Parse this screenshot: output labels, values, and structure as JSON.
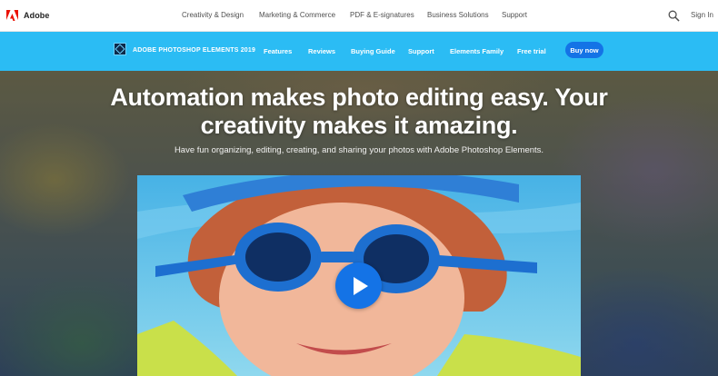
{
  "global_nav": {
    "brand": "Adobe",
    "links": [
      "Creativity & Design",
      "Marketing & Commerce",
      "PDF & E-signatures",
      "Business Solutions",
      "Support"
    ],
    "signin": "Sign In"
  },
  "product_nav": {
    "product_name": "ADOBE PHOTOSHOP ELEMENTS 2019",
    "items": [
      "Features",
      "Reviews",
      "Buying Guide",
      "Support",
      "Elements Family",
      "Free trial"
    ],
    "cta": "Buy now"
  },
  "hero": {
    "headline": "Automation makes photo editing easy. Your creativity makes it amazing.",
    "subhead": "Have fun organizing, editing, creating, and sharing your photos with Adobe Photoshop Elements."
  },
  "colors": {
    "brand_red": "#eb1000",
    "product_nav_bg": "#2bbcf4",
    "cta_blue": "#1473e6"
  }
}
